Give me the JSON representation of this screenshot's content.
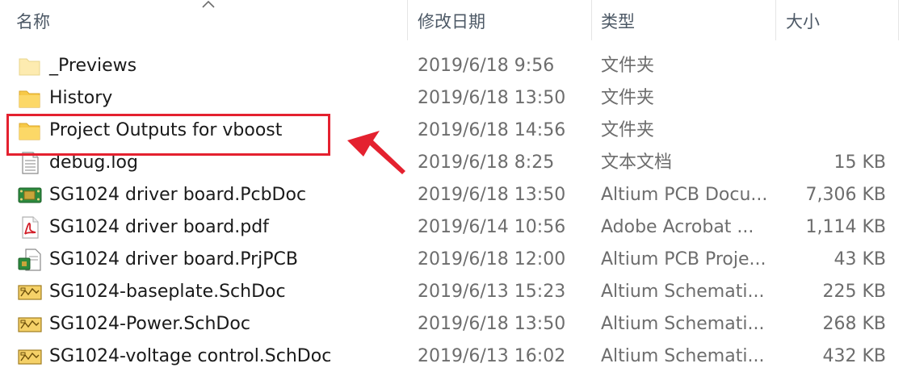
{
  "columns": {
    "name": "名称",
    "date": "修改日期",
    "type": "类型",
    "size": "大小"
  },
  "files": [
    {
      "icon": "folder-faded-icon",
      "name": "_Previews",
      "date": "2019/6/18 9:56",
      "type": "文件夹",
      "size": ""
    },
    {
      "icon": "folder-icon",
      "name": "History",
      "date": "2019/6/18 13:50",
      "type": "文件夹",
      "size": ""
    },
    {
      "icon": "folder-icon",
      "name": "Project Outputs for vboost",
      "date": "2019/6/18 14:56",
      "type": "文件夹",
      "size": ""
    },
    {
      "icon": "text-file-icon",
      "name": "debug.log",
      "date": "2019/6/18 8:25",
      "type": "文本文档",
      "size": "15 KB"
    },
    {
      "icon": "pcb-doc-icon",
      "name": "SG1024 driver board.PcbDoc",
      "date": "2019/6/18 13:50",
      "type": "Altium PCB Docu...",
      "size": "7,306 KB"
    },
    {
      "icon": "pdf-icon",
      "name": "SG1024 driver board.pdf",
      "date": "2019/6/14 10:56",
      "type": "Adobe Acrobat ...",
      "size": "1,114 KB"
    },
    {
      "icon": "pcb-project-icon",
      "name": "SG1024 driver board.PrjPCB",
      "date": "2019/6/18 12:00",
      "type": "Altium PCB Proje...",
      "size": "43 KB"
    },
    {
      "icon": "schematic-icon",
      "name": "SG1024-baseplate.SchDoc",
      "date": "2019/6/13 15:23",
      "type": "Altium Schemati...",
      "size": "225 KB"
    },
    {
      "icon": "schematic-icon",
      "name": "SG1024-Power.SchDoc",
      "date": "2019/6/18 13:50",
      "type": "Altium Schemati...",
      "size": "268 KB"
    },
    {
      "icon": "schematic-icon",
      "name": "SG1024-voltage control.SchDoc",
      "date": "2019/6/13 16:02",
      "type": "Altium Schemati...",
      "size": "432 KB"
    }
  ],
  "annotation": {
    "highlight_color": "#e4212f",
    "highlighted_item": "Project Outputs for vboost"
  },
  "sort": {
    "column": "name",
    "direction": "ascending"
  }
}
